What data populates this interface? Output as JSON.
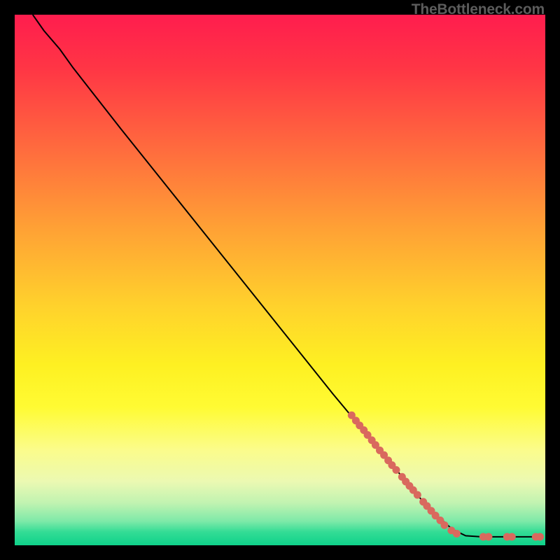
{
  "watermark": "TheBottleneck.com",
  "chart_data": {
    "type": "line",
    "title": "",
    "xlabel": "",
    "ylabel": "",
    "xlim": [
      0,
      100
    ],
    "ylim": [
      0,
      100
    ],
    "background_gradient_stops": [
      {
        "t": 0.0,
        "color": "#ff1d4e"
      },
      {
        "t": 0.1,
        "color": "#ff3545"
      },
      {
        "t": 0.25,
        "color": "#ff6a3e"
      },
      {
        "t": 0.4,
        "color": "#ffa035"
      },
      {
        "t": 0.55,
        "color": "#ffd22c"
      },
      {
        "t": 0.66,
        "color": "#fef022"
      },
      {
        "t": 0.74,
        "color": "#fffb33"
      },
      {
        "t": 0.82,
        "color": "#fbfc8b"
      },
      {
        "t": 0.88,
        "color": "#ebf9b2"
      },
      {
        "t": 0.92,
        "color": "#c1f3b1"
      },
      {
        "t": 0.955,
        "color": "#7de9a8"
      },
      {
        "t": 0.975,
        "color": "#33dc95"
      },
      {
        "t": 1.0,
        "color": "#0fd28a"
      }
    ],
    "curve_points": [
      {
        "x": 3.4,
        "y": 100.0
      },
      {
        "x": 5.5,
        "y": 97.0
      },
      {
        "x": 8.5,
        "y": 93.5
      },
      {
        "x": 11.0,
        "y": 90.0
      },
      {
        "x": 20.0,
        "y": 78.5
      },
      {
        "x": 30.0,
        "y": 66.0
      },
      {
        "x": 40.0,
        "y": 53.5
      },
      {
        "x": 50.0,
        "y": 41.0
      },
      {
        "x": 60.0,
        "y": 28.5
      },
      {
        "x": 70.0,
        "y": 16.5
      },
      {
        "x": 78.0,
        "y": 7.0
      },
      {
        "x": 82.5,
        "y": 3.0
      },
      {
        "x": 85.0,
        "y": 1.8
      },
      {
        "x": 88.0,
        "y": 1.6
      },
      {
        "x": 92.0,
        "y": 1.6
      },
      {
        "x": 96.0,
        "y": 1.6
      },
      {
        "x": 99.0,
        "y": 1.6
      }
    ],
    "scatter_points": [
      {
        "x": 63.5,
        "y": 24.5
      },
      {
        "x": 64.3,
        "y": 23.5
      },
      {
        "x": 65.0,
        "y": 22.6
      },
      {
        "x": 65.8,
        "y": 21.7
      },
      {
        "x": 66.5,
        "y": 20.8
      },
      {
        "x": 67.3,
        "y": 19.8
      },
      {
        "x": 68.0,
        "y": 18.9
      },
      {
        "x": 68.8,
        "y": 17.9
      },
      {
        "x": 69.6,
        "y": 17.0
      },
      {
        "x": 70.4,
        "y": 16.0
      },
      {
        "x": 71.1,
        "y": 15.1
      },
      {
        "x": 71.9,
        "y": 14.2
      },
      {
        "x": 73.0,
        "y": 12.9
      },
      {
        "x": 73.7,
        "y": 12.0
      },
      {
        "x": 74.4,
        "y": 11.2
      },
      {
        "x": 75.1,
        "y": 10.4
      },
      {
        "x": 75.9,
        "y": 9.5
      },
      {
        "x": 77.0,
        "y": 8.2
      },
      {
        "x": 77.7,
        "y": 7.4
      },
      {
        "x": 78.5,
        "y": 6.5
      },
      {
        "x": 79.3,
        "y": 5.6
      },
      {
        "x": 80.2,
        "y": 4.7
      },
      {
        "x": 81.0,
        "y": 3.8
      },
      {
        "x": 82.3,
        "y": 2.8
      },
      {
        "x": 83.3,
        "y": 2.2
      },
      {
        "x": 88.3,
        "y": 1.6
      },
      {
        "x": 89.3,
        "y": 1.6
      },
      {
        "x": 92.8,
        "y": 1.6
      },
      {
        "x": 93.7,
        "y": 1.6
      },
      {
        "x": 98.2,
        "y": 1.6
      },
      {
        "x": 99.0,
        "y": 1.6
      }
    ],
    "scatter_radius": 5.5,
    "scatter_color": "#d9695e",
    "line_color": "#000000",
    "line_width": 2
  }
}
